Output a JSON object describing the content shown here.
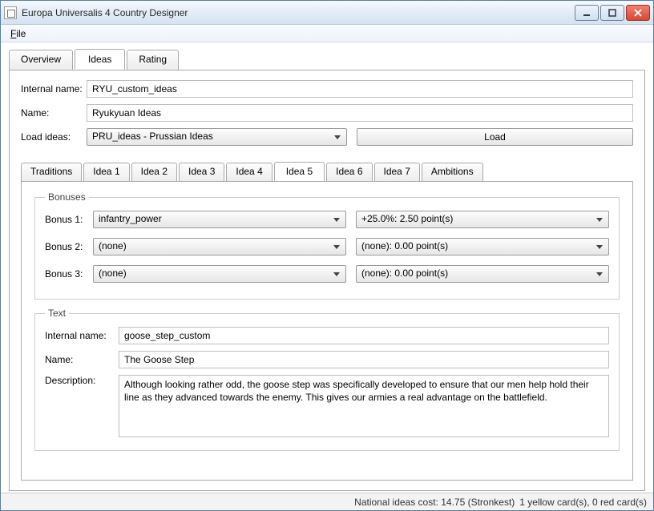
{
  "window": {
    "title": "Europa Universalis 4 Country Designer"
  },
  "menu": {
    "file": "File"
  },
  "topTabs": {
    "overview": "Overview",
    "ideas": "Ideas",
    "rating": "Rating"
  },
  "ideas": {
    "internalNameLabel": "Internal name:",
    "internalName": "RYU_custom_ideas",
    "nameLabel": "Name:",
    "name": "Ryukyuan Ideas",
    "loadIdeasLabel": "Load ideas:",
    "loadIdeasValue": "PRU_ideas - Prussian Ideas",
    "loadBtn": "Load"
  },
  "innerTabs": {
    "traditions": "Traditions",
    "i1": "Idea 1",
    "i2": "Idea 2",
    "i3": "Idea 3",
    "i4": "Idea 4",
    "i5": "Idea 5",
    "i6": "Idea 6",
    "i7": "Idea 7",
    "ambitions": "Ambitions"
  },
  "bonuses": {
    "legend": "Bonuses",
    "b1Label": "Bonus 1:",
    "b1Type": "infantry_power",
    "b1Val": "+25.0%: 2.50 point(s)",
    "b2Label": "Bonus 2:",
    "b2Type": "(none)",
    "b2Val": "(none): 0.00 point(s)",
    "b3Label": "Bonus 3:",
    "b3Type": "(none)",
    "b3Val": "(none): 0.00 point(s)"
  },
  "text": {
    "legend": "Text",
    "internalNameLabel": "Internal name:",
    "internalName": "goose_step_custom",
    "nameLabel": "Name:",
    "name": "The Goose Step",
    "descLabel": "Description:",
    "desc": "Although looking rather odd, the goose step was specifically developed to ensure that our men help hold their line as they advanced towards the enemy. This gives our armies a real advantage on the battlefield."
  },
  "status": {
    "cost": "National ideas cost: 14.75 (Stronkest)",
    "cards": "1 yellow card(s), 0 red card(s)"
  }
}
